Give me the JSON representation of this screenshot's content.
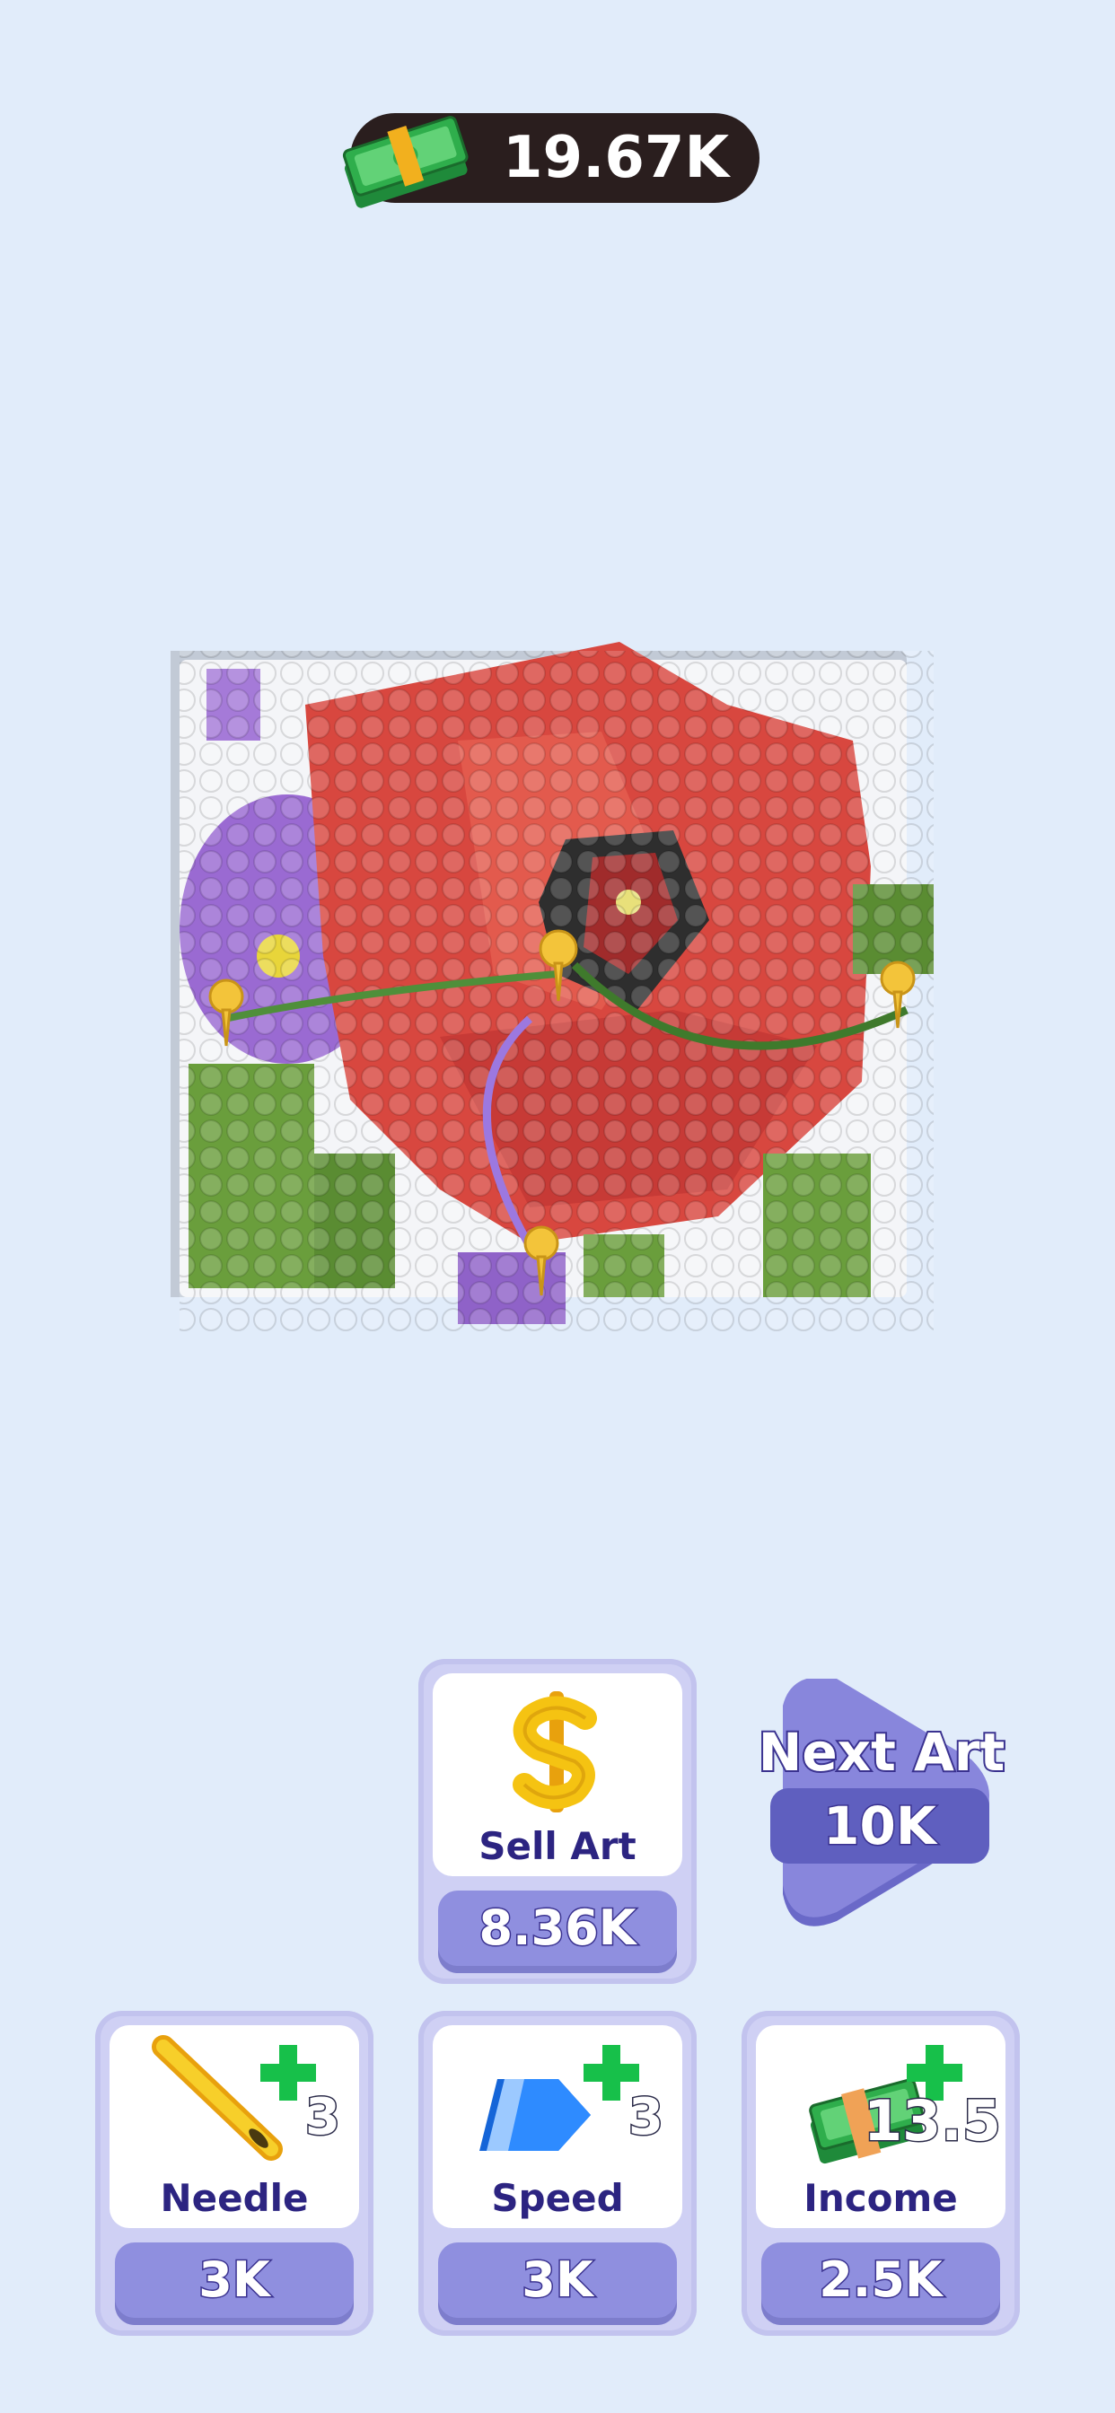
{
  "currency": {
    "amount": "19.67K",
    "icon": "cash-stack-icon"
  },
  "sell": {
    "label": "Sell Art",
    "price": "8.36K",
    "icon": "dollar-sign-icon"
  },
  "next_art": {
    "label": "Next Art",
    "price": "10K"
  },
  "upgrades": [
    {
      "label": "Needle",
      "level": "3",
      "price": "3K",
      "icon": "needle-icon"
    },
    {
      "label": "Speed",
      "level": "3",
      "price": "3K",
      "icon": "speed-arrow-icon"
    },
    {
      "label": "Income",
      "level": "13.5",
      "price": "2.5K",
      "icon": "cash-income-icon"
    }
  ],
  "colors": {
    "background": "#e1ecfa",
    "pill": "#2a1e1e",
    "card": "#cfd0f4",
    "price_bar": "#8f8fdf",
    "label": "#2c2481",
    "plus": "#17c04a"
  }
}
